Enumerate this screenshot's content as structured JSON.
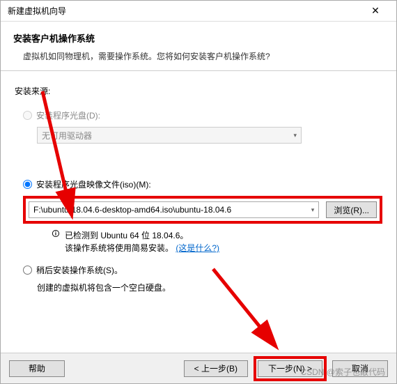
{
  "window": {
    "title": "新建虚拟机向导"
  },
  "header": {
    "h1": "安装客户机操作系统",
    "desc": "虚拟机如同物理机，需要操作系统。您将如何安装客户机操作系统?"
  },
  "source_label": "安装来源:",
  "opt_disc": {
    "label": "安装程序光盘(D):",
    "dropdown": "无可用驱动器"
  },
  "opt_iso": {
    "label": "安装程序光盘映像文件(iso)(M):",
    "value": "F:\\ubuntu-18.04.6-desktop-amd64.iso\\ubuntu-18.04.6",
    "browse": "浏览(R)...",
    "detected_line1": "已检测到 Ubuntu 64 位 18.04.6。",
    "detected_line2_a": "该操作系统将使用简易安装。",
    "detected_link": "(这是什么?)"
  },
  "opt_later": {
    "label": "稍后安装操作系统(S)。",
    "note": "创建的虚拟机将包含一个空白硬盘。"
  },
  "footer": {
    "help": "帮助",
    "back": "< 上一步(B)",
    "next": "下一步(N) >",
    "cancel": "取消"
  },
  "watermark": "CSDN @索子也敲代码"
}
